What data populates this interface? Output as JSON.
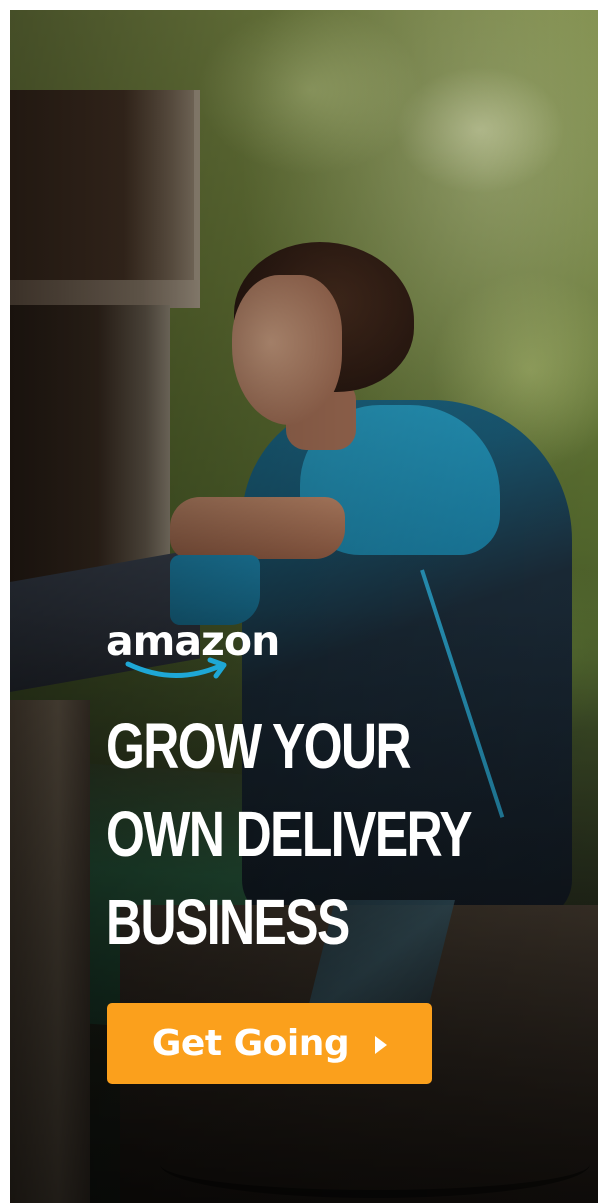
{
  "ad": {
    "logo": {
      "wordmark": "amazon",
      "icon": "amazon-smile-arrow-icon"
    },
    "headline": {
      "lines": [
        "GROW YOUR",
        "OWN DELIVERY",
        "BUSINESS"
      ]
    },
    "cta": {
      "label": "Get Going",
      "icon": "play-arrow-icon"
    },
    "colors": {
      "cta_background": "#fba01c",
      "text": "#ffffff",
      "smile_accent": "#1ea7d6"
    }
  }
}
